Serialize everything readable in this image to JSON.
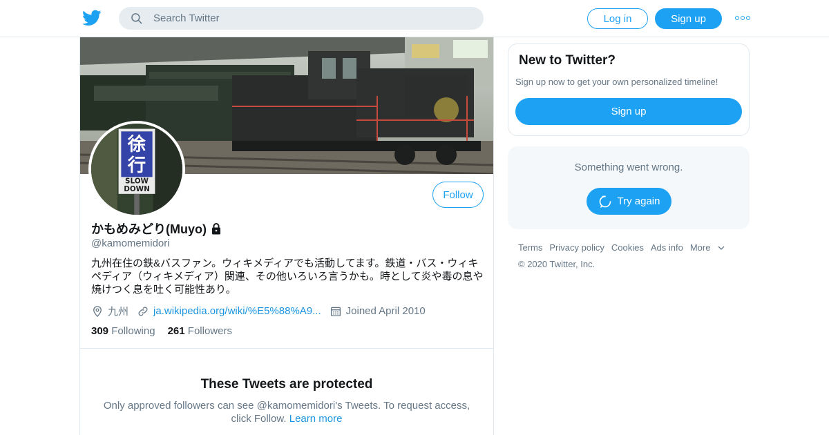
{
  "header": {
    "search_placeholder": "Search Twitter",
    "login_label": "Log in",
    "signup_label": "Sign up",
    "accent_color": "#1da1f2"
  },
  "profile": {
    "name": "かもめみどり(Muyo)",
    "handle": "@kamomemidori",
    "bio": "九州在住の鉄&バスファン。ウィキメディアでも活動してます。鉄道・バス・ウィキペディア（ウィキメディア）関連、その他いろいろ言うかも。時として炎や毒の息や焼けつく息を吐く可能性あり。",
    "location": "九州",
    "url": "ja.wikipedia.org/wiki/%E5%88%A9...",
    "joined": "Joined April 2010",
    "following_count": "309",
    "following_label": "Following",
    "followers_count": "261",
    "followers_label": "Followers",
    "follow_button": "Follow",
    "avatar_sign_top": "徐",
    "avatar_sign_bottom": "行",
    "avatar_sign_en1": "SLOW",
    "avatar_sign_en2": "DOWN"
  },
  "protected": {
    "title": "These Tweets are protected",
    "text": "Only approved followers can see @kamomemidori's Tweets. To request access, click Follow.",
    "learn_more": "Learn more"
  },
  "sidebar": {
    "new_title": "New to Twitter?",
    "new_subtitle": "Sign up now to get your own personalized timeline!",
    "signup_label": "Sign up",
    "error_text": "Something went wrong.",
    "retry_label": "Try again"
  },
  "footer": {
    "links": [
      "Terms",
      "Privacy policy",
      "Cookies",
      "Ads info",
      "More"
    ],
    "copyright": "© 2020 Twitter, Inc."
  }
}
